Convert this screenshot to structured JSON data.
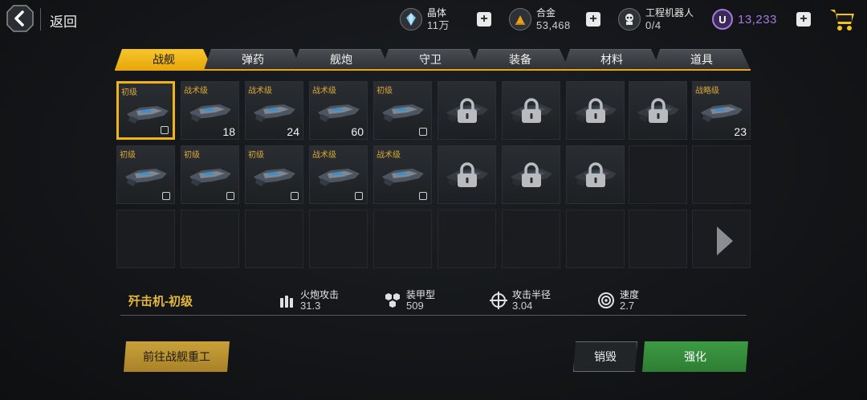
{
  "header": {
    "back_label": "返回",
    "resources": [
      {
        "name": "晶体",
        "value": "11万"
      },
      {
        "name": "合金",
        "value": "53,468"
      },
      {
        "name": "工程机器人",
        "value": "0/4"
      },
      {
        "name": "",
        "value": "13,233"
      }
    ],
    "premium_letter": "U"
  },
  "tabs": [
    "战舰",
    "弹药",
    "舰炮",
    "守卫",
    "装备",
    "材料",
    "道具"
  ],
  "active_tab": 0,
  "grid": {
    "rows": [
      [
        {
          "grade": "初级",
          "count": "",
          "state": "owned",
          "selected": true
        },
        {
          "grade": "战术级",
          "count": "18",
          "state": "owned"
        },
        {
          "grade": "战术级",
          "count": "24",
          "state": "owned"
        },
        {
          "grade": "战术级",
          "count": "60",
          "state": "owned"
        },
        {
          "grade": "初级",
          "count": "",
          "state": "owned"
        },
        {
          "grade": "",
          "count": "",
          "state": "locked"
        },
        {
          "grade": "",
          "count": "",
          "state": "locked"
        },
        {
          "grade": "",
          "count": "",
          "state": "locked"
        },
        {
          "grade": "",
          "count": "",
          "state": "locked"
        },
        {
          "grade": "战略级",
          "count": "23",
          "state": "owned"
        }
      ],
      [
        {
          "grade": "初级",
          "count": "",
          "state": "owned"
        },
        {
          "grade": "初级",
          "count": "",
          "state": "owned"
        },
        {
          "grade": "初级",
          "count": "",
          "state": "owned"
        },
        {
          "grade": "战术级",
          "count": "",
          "state": "owned"
        },
        {
          "grade": "战术级",
          "count": "",
          "state": "owned"
        },
        {
          "grade": "",
          "count": "",
          "state": "locked"
        },
        {
          "grade": "",
          "count": "",
          "state": "locked"
        },
        {
          "grade": "",
          "count": "",
          "state": "locked"
        },
        {
          "grade": "",
          "count": "",
          "state": "empty"
        },
        {
          "grade": "",
          "count": "",
          "state": "empty"
        }
      ],
      [
        {
          "grade": "",
          "count": "",
          "state": "empty"
        },
        {
          "grade": "",
          "count": "",
          "state": "empty"
        },
        {
          "grade": "",
          "count": "",
          "state": "empty"
        },
        {
          "grade": "",
          "count": "",
          "state": "empty"
        },
        {
          "grade": "",
          "count": "",
          "state": "empty"
        },
        {
          "grade": "",
          "count": "",
          "state": "empty"
        },
        {
          "grade": "",
          "count": "",
          "state": "empty"
        },
        {
          "grade": "",
          "count": "",
          "state": "empty"
        },
        {
          "grade": "",
          "count": "",
          "state": "empty"
        },
        {
          "grade": "",
          "count": "",
          "state": "next"
        }
      ]
    ]
  },
  "selected_ship": {
    "name": "歼击机-初级",
    "stats": [
      {
        "label": "火炮攻击",
        "value": "31.3",
        "icon": "ammo-icon"
      },
      {
        "label": "装甲型",
        "value": "509",
        "icon": "armor-icon"
      },
      {
        "label": "攻击半径",
        "value": "3.04",
        "icon": "crosshair-icon"
      },
      {
        "label": "速度",
        "value": "2.7",
        "icon": "speed-icon"
      }
    ]
  },
  "actions": {
    "heavy_industry": "前往战舰重工",
    "destroy": "销毁",
    "enhance": "强化"
  },
  "colors": {
    "accent": "#f0b414",
    "grade": "#d9a73a",
    "enhance": "#3c9a43",
    "premium": "#a47ae0"
  }
}
